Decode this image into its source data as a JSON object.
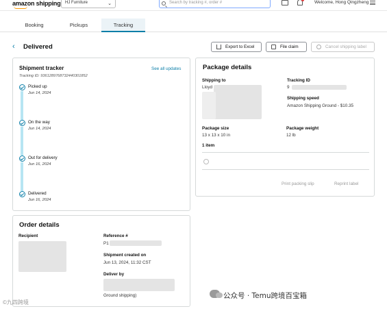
{
  "header": {
    "logo": "amazon shipping",
    "store": "HJ Furniture",
    "search_placeholder": "Search by tracking #, order #",
    "welcome": "Welcome, Hong Qingzheng"
  },
  "tabs": [
    {
      "label": "Booking"
    },
    {
      "label": "Pickups"
    },
    {
      "label": "Tracking"
    }
  ],
  "page": {
    "title": "Delivered",
    "buttons": {
      "export": "Export to Excel",
      "file_claim": "File claim",
      "cancel": "Cancel shipping label"
    }
  },
  "tracker": {
    "title": "Shipment tracker",
    "see_all": "See all updates",
    "tracking_id": "Tracking ID: 9361289768732440301852",
    "steps": [
      {
        "name": "Picked up",
        "date": "Jun 14, 2024"
      },
      {
        "name": "On the way",
        "date": "Jun 14, 2024"
      },
      {
        "name": "Out for delivery",
        "date": "Jun 16, 2024"
      },
      {
        "name": "Delivered",
        "date": "Jun 16, 2024"
      }
    ]
  },
  "package": {
    "title": "Package details",
    "shipping_to_label": "Shipping to",
    "shipping_to_name": "Lloyd",
    "tracking_id_label": "Tracking ID",
    "tracking_id_value": "9",
    "shipping_speed_label": "Shipping speed",
    "shipping_speed_value": "Amazon Shipping Ground - $10.35",
    "size_label": "Package size",
    "size_value": "13 x 13 x 10 in",
    "weight_label": "Package weight",
    "weight_value": "12 lb",
    "items": "1 item",
    "print_slip": "Print packing slip",
    "reprint_label": "Reprint label"
  },
  "order": {
    "title": "Order details",
    "recipient_label": "Recipient",
    "reference_label": "Reference #",
    "reference_value": "P1",
    "created_label": "Shipment created on",
    "created_value": "Jun 13, 2024, 11:32 CST",
    "deliver_by_label": "Deliver by",
    "deliver_by_note": "Ground shipping)"
  },
  "watermark": "公众号 · Temu跨境百宝箱",
  "watermark_left": "©九四跨境"
}
